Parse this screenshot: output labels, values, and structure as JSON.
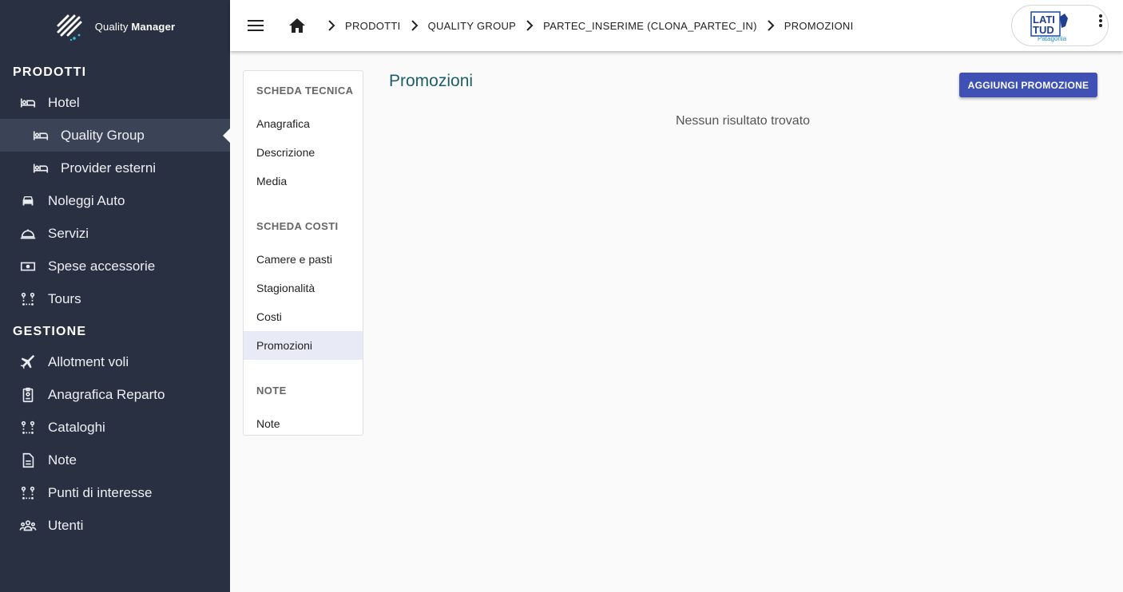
{
  "app": {
    "brand_name_light": "Quality",
    "brand_name_bold": "Manager"
  },
  "sidebar": {
    "sections": [
      {
        "title": "PRODOTTI"
      },
      {
        "title": "GESTIONE"
      }
    ],
    "prodotti_items": [
      {
        "label": "Hotel",
        "icon": "bed-icon"
      },
      {
        "label": "Quality Group",
        "icon": "bed-icon",
        "active": true
      },
      {
        "label": "Provider esterni",
        "icon": "bed-icon"
      },
      {
        "label": "Noleggi Auto",
        "icon": "car-icon"
      },
      {
        "label": "Servizi",
        "icon": "room-service-icon"
      },
      {
        "label": "Spese accessorie",
        "icon": "money-icon"
      },
      {
        "label": "Tours",
        "icon": "route-icon"
      }
    ],
    "gestione_items": [
      {
        "label": "Allotment voli",
        "icon": "airplane-icon"
      },
      {
        "label": "Anagrafica Reparto",
        "icon": "badge-icon"
      },
      {
        "label": "Cataloghi",
        "icon": "route-icon"
      },
      {
        "label": "Note",
        "icon": "document-icon"
      },
      {
        "label": "Punti di interesse",
        "icon": "route-icon"
      },
      {
        "label": "Utenti",
        "icon": "group-icon"
      }
    ]
  },
  "breadcrumb": [
    "PRODOTTI",
    "QUALITY GROUP",
    "PARTEC_INSERIME (CLONA_PARTEC_IN)",
    "PROMOZIONI"
  ],
  "header": {
    "logo_text_1": "LATI",
    "logo_text_2": "TUD",
    "logo_text_3": "Patagonia"
  },
  "card_menu": {
    "scheda_tecnica": {
      "heading": "SCHEDA TECNICA",
      "items": [
        "Anagrafica",
        "Descrizione",
        "Media"
      ]
    },
    "scheda_costi": {
      "heading": "SCHEDA COSTI",
      "items": [
        "Camere e pasti",
        "Stagionalità",
        "Costi",
        "Promozioni"
      ]
    },
    "note": {
      "heading": "NOTE",
      "items": [
        "Note"
      ]
    }
  },
  "main": {
    "title": "Promozioni",
    "add_button": "AGGIUNGI PROMOZIONE",
    "empty_message": "Nessun risultato trovato"
  },
  "colors": {
    "sidebar_bg": "#283042",
    "primary": "#3f51b5",
    "title": "#1e5e6b",
    "active_menu": "#e8eaf6"
  }
}
